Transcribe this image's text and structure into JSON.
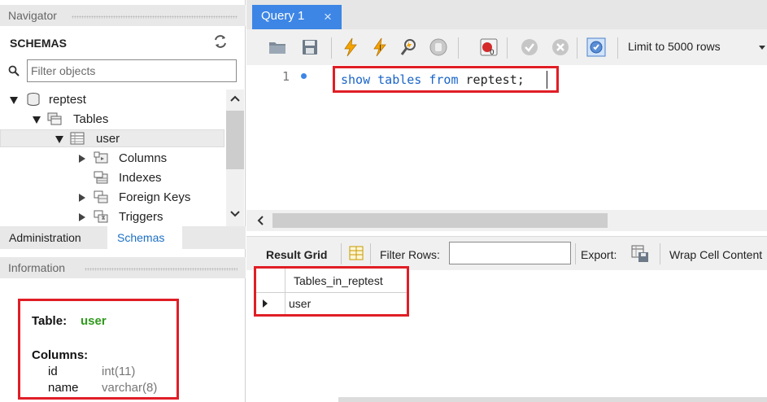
{
  "navigator": {
    "header": "Navigator",
    "schemas_title": "SCHEMAS",
    "filter_placeholder": "Filter objects",
    "tree": [
      {
        "label": "reptest",
        "icon": "database-icon",
        "expanded": true
      },
      {
        "label": "Tables",
        "icon": "tables-folder-icon",
        "expanded": true
      },
      {
        "label": "user",
        "icon": "table-icon",
        "expanded": true,
        "selected": true
      },
      {
        "label": "Columns",
        "icon": "columns-icon",
        "expanded": false
      },
      {
        "label": "Indexes",
        "icon": "indexes-icon",
        "expanded": null
      },
      {
        "label": "Foreign Keys",
        "icon": "foreign-keys-icon",
        "expanded": false
      },
      {
        "label": "Triggers",
        "icon": "triggers-icon",
        "expanded": false
      }
    ],
    "tabs": {
      "administration": "Administration",
      "schemas": "Schemas"
    }
  },
  "information": {
    "header": "Information",
    "table_label": "Table:",
    "table_name": "user",
    "columns_label": "Columns:",
    "columns": [
      {
        "name": "id",
        "type": "int(11)"
      },
      {
        "name": "name",
        "type": "varchar(8)"
      }
    ]
  },
  "editor": {
    "tab_title": "Query 1",
    "tab_close": "×",
    "limit_label": "Limit to 5000 rows",
    "line_number": "1",
    "sql": {
      "kw1": "show",
      "kw2": "tables",
      "kw3": "from",
      "ident": "reptest",
      "semi": ";"
    }
  },
  "results": {
    "result_grid_label": "Result Grid",
    "filter_rows_label": "Filter Rows:",
    "export_label": "Export:",
    "wrap_label": "Wrap Cell Content",
    "column_header": "Tables_in_reptest",
    "rows": [
      "user"
    ]
  },
  "colors": {
    "highlight_border": "#e01e26",
    "accent_blue": "#3d86e6",
    "keyword_blue": "#1a64c8",
    "table_name_green": "#2f9a1c"
  }
}
